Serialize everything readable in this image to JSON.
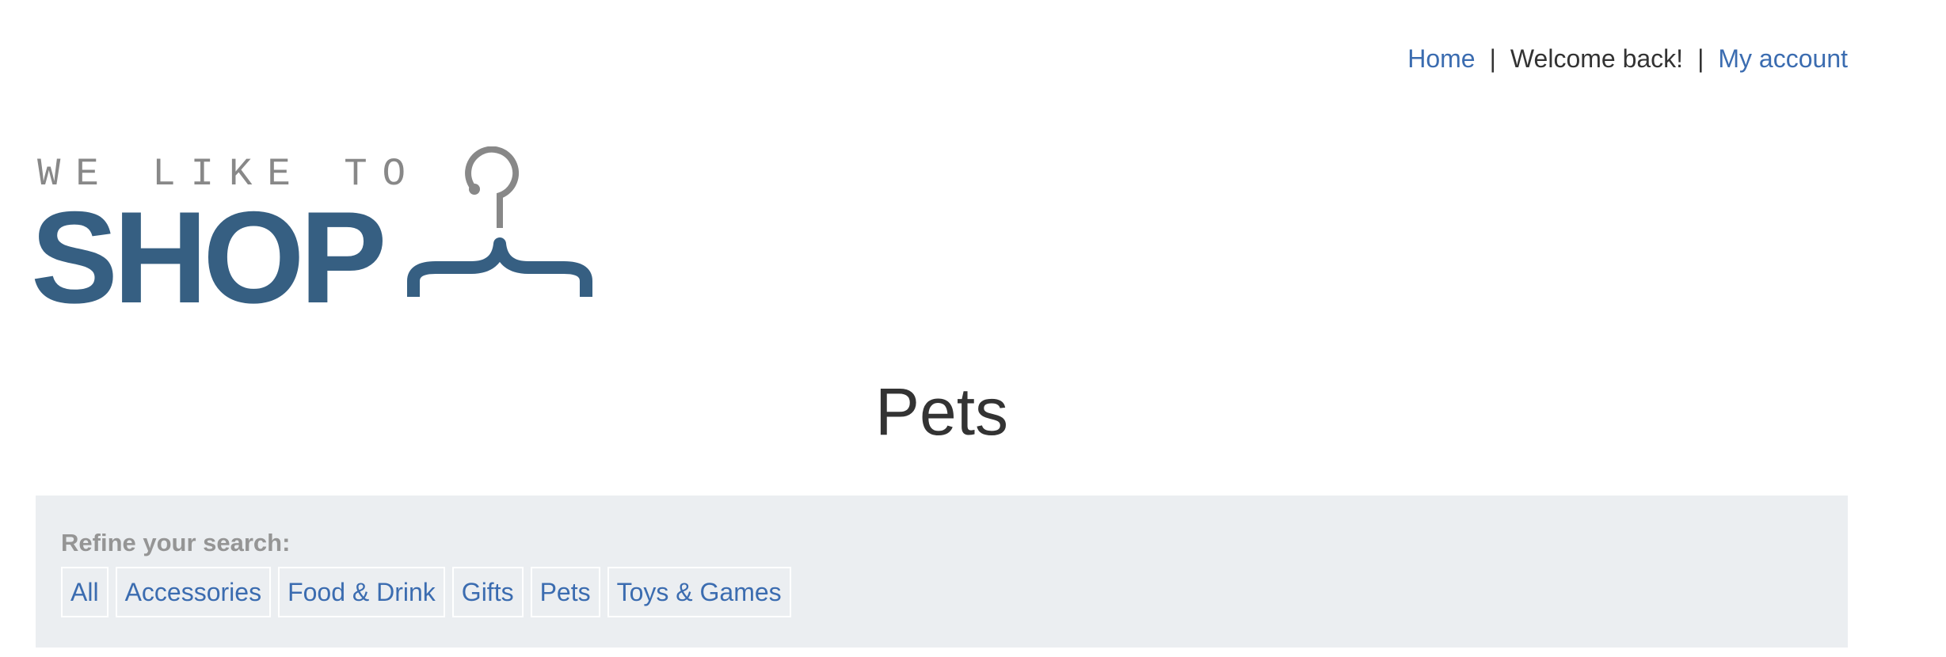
{
  "header": {
    "nav": {
      "home_label": "Home",
      "separator": "|",
      "welcome_text": "Welcome back!",
      "account_label": "My account"
    },
    "logo": {
      "tagline": "WE LIKE TO",
      "word": "SHOP",
      "icon": "clothes-hanger-icon"
    }
  },
  "main": {
    "title": "Pets",
    "filter": {
      "label": "Refine your search:",
      "options": [
        {
          "label": "All"
        },
        {
          "label": "Accessories"
        },
        {
          "label": "Food & Drink"
        },
        {
          "label": "Gifts"
        },
        {
          "label": "Pets"
        },
        {
          "label": "Toys & Games"
        }
      ]
    }
  },
  "colors": {
    "link": "#3b6cb0",
    "logo_blue": "#365f82",
    "logo_gray": "#888888",
    "panel_bg": "#ebeef1"
  }
}
